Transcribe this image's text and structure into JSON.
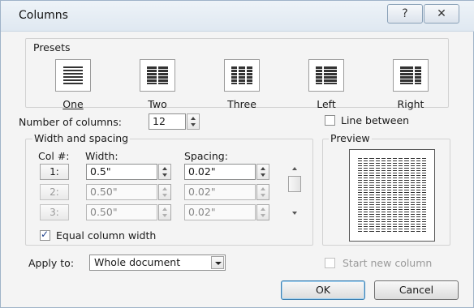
{
  "window": {
    "title": "Columns",
    "help_icon": "?",
    "close_icon": "✕"
  },
  "presets": {
    "group_label": "Presets",
    "items": [
      {
        "key": "one",
        "label": "One",
        "cols": 1
      },
      {
        "key": "two",
        "label": "Two",
        "cols": 2
      },
      {
        "key": "three",
        "label": "Three",
        "cols": 3
      },
      {
        "key": "left",
        "label": "Left",
        "cols": 2
      },
      {
        "key": "right",
        "label": "Right",
        "cols": 2
      }
    ]
  },
  "number_of_columns": {
    "label": "Number of columns:",
    "value": "12"
  },
  "line_between": {
    "label": "Line between",
    "checked": false
  },
  "width_spacing": {
    "group_label": "Width and spacing",
    "col_header": "Col #:",
    "width_header": "Width:",
    "spacing_header": "Spacing:",
    "rows": [
      {
        "col": "1:",
        "width": "0.5\"",
        "spacing": "0.02\"",
        "enabled": true
      },
      {
        "col": "2:",
        "width": "0.50\"",
        "spacing": "0.02\"",
        "enabled": false
      },
      {
        "col": "3:",
        "width": "0.50\"",
        "spacing": "0.02\"",
        "enabled": false
      }
    ]
  },
  "equal_column_width": {
    "label": "Equal column width",
    "checked": true
  },
  "preview": {
    "label": "Preview"
  },
  "apply_to": {
    "label": "Apply to:",
    "value": "Whole document"
  },
  "start_new_column": {
    "label": "Start new column",
    "checked": false,
    "enabled": false
  },
  "buttons": {
    "ok": "OK",
    "cancel": "Cancel"
  }
}
